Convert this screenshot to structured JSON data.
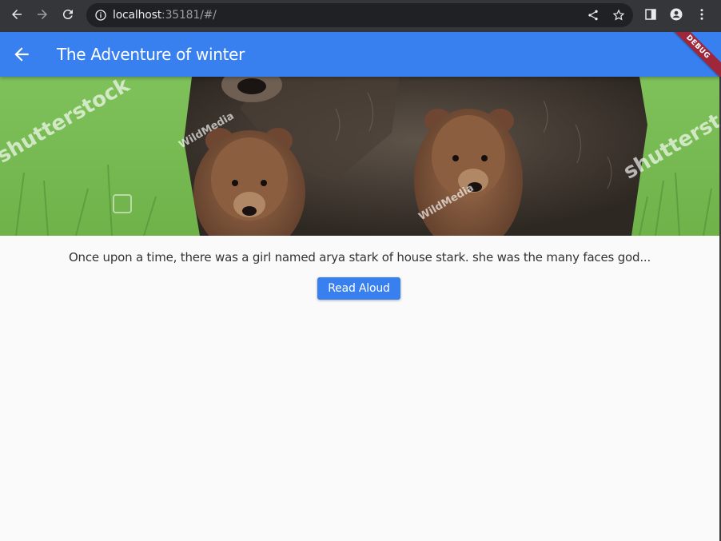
{
  "browser": {
    "url_host": "localhost",
    "url_rest": ":35181/#/",
    "icons": [
      "back-arrow-icon",
      "forward-arrow-icon",
      "reload-icon",
      "info-icon",
      "share-icon",
      "star-icon",
      "side-panel-icon",
      "profile-icon",
      "more-menu-icon"
    ]
  },
  "app_bar": {
    "title": "The Adventure of winter",
    "debug_label": "DEBUG",
    "color": "#3880f0"
  },
  "hero": {
    "watermarks": [
      "shutterstock",
      "WildMedia",
      "WildMedia",
      "shutterstock"
    ]
  },
  "story": {
    "text": "Once upon a time, there was a girl named arya stark of house stark. she was the many faces god...",
    "read_button_label": "Read Aloud"
  }
}
